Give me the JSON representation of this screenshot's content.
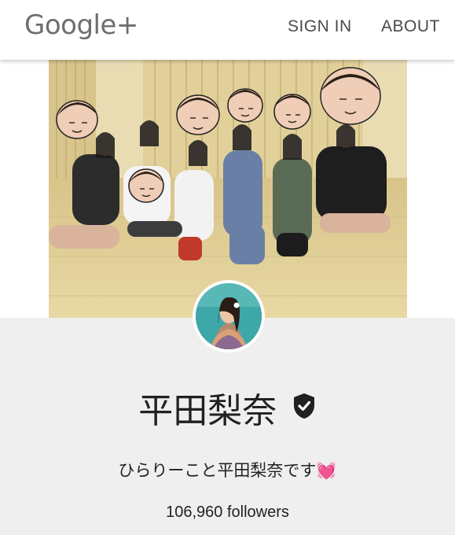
{
  "header": {
    "logo_text": "Google+",
    "sign_in_label": "SIGN IN",
    "about_label": "ABOUT"
  },
  "profile": {
    "name": "平田梨奈",
    "verified_icon": "verified-check-icon",
    "tagline": "ひらりーこと平田梨奈です",
    "tagline_emoji": "💓",
    "followers": "106,960 followers"
  },
  "colors": {
    "header_bg": "#ffffff",
    "page_bg": "#efefef",
    "text": "#212121",
    "logo": "#6e6e6e",
    "heart": "#e75aa8"
  }
}
